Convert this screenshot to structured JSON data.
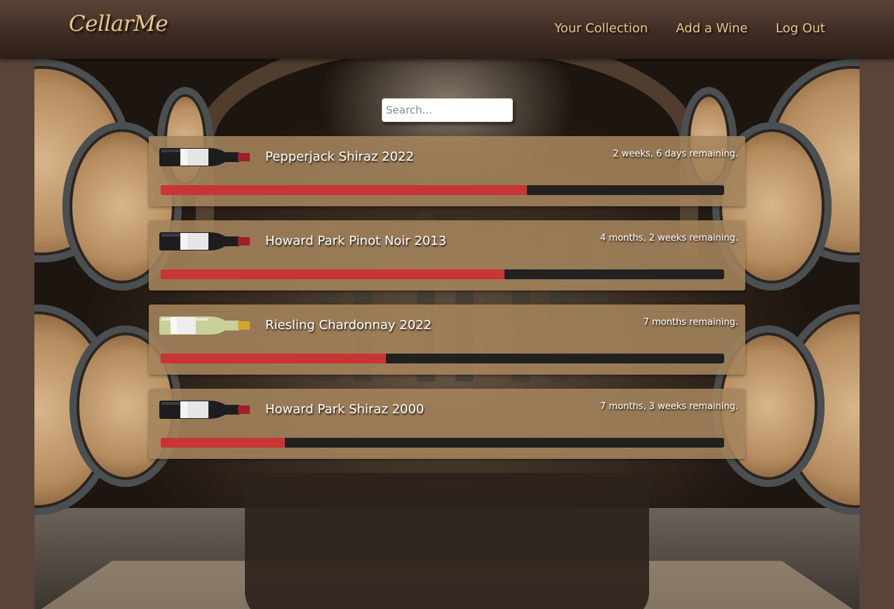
{
  "header": {
    "logo": "CellarMe",
    "nav": [
      {
        "label": "Your Collection"
      },
      {
        "label": "Add a Wine"
      },
      {
        "label": "Log Out"
      }
    ]
  },
  "search": {
    "placeholder": "Search...",
    "value": ""
  },
  "wines": [
    {
      "name": "Pepperjack Shiraz 2022",
      "remaining": "2 weeks, 6 days remaining.",
      "progress": 0.65,
      "bottle": "red-wine-bottle-icon"
    },
    {
      "name": "Howard Park Pinot Noir 2013",
      "remaining": "4 months, 2 weeks remaining.",
      "progress": 0.61,
      "bottle": "red-wine-bottle-icon"
    },
    {
      "name": "Riesling Chardonnay 2022",
      "remaining": "7 months remaining.",
      "progress": 0.4,
      "bottle": "white-wine-bottle-icon"
    },
    {
      "name": "Howard Park Shiraz 2000",
      "remaining": "7 months, 3 weeks remaining.",
      "progress": 0.22,
      "bottle": "red-wine-bottle-icon"
    }
  ],
  "colors": {
    "accent": "#e9c48a",
    "progress_fill": "#c73535",
    "progress_track": "#222120",
    "card_bg": "#a5845c",
    "header_bg": "#3f2d24",
    "page_bg": "#5a4439"
  }
}
